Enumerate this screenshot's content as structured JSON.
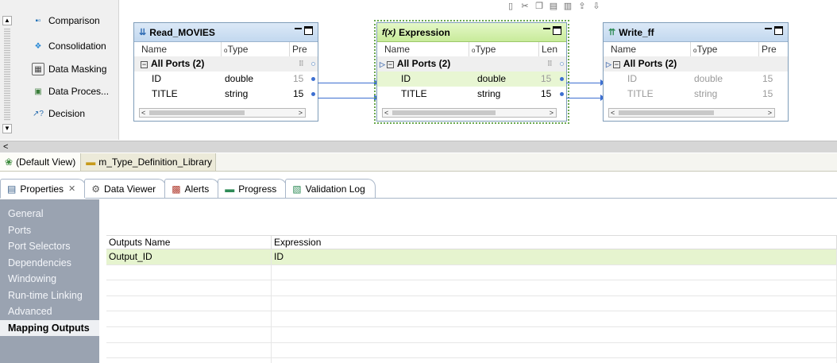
{
  "palette": {
    "items": [
      {
        "label": "Comparison",
        "icon": "comparison-icon"
      },
      {
        "label": "Consolidation",
        "icon": "consolidation-icon"
      },
      {
        "label": "Data Masking",
        "icon": "data-masking-icon"
      },
      {
        "label": "Data Proces...",
        "icon": "data-processor-icon"
      },
      {
        "label": "Decision",
        "icon": "decision-icon"
      }
    ]
  },
  "transformations": {
    "read": {
      "title": "Read_MOVIES",
      "columns": [
        "Name",
        "Type",
        "Pre"
      ],
      "group": "All Ports (2)",
      "ports": [
        {
          "name": "ID",
          "type": "double",
          "precision": "15"
        },
        {
          "name": "TITLE",
          "type": "string",
          "precision": "15"
        }
      ]
    },
    "expression": {
      "title": "Expression",
      "icon_label": "f(x)",
      "columns": [
        "Name",
        "Type",
        "Len"
      ],
      "group": "All Ports (2)",
      "ports": [
        {
          "name": "ID",
          "type": "double",
          "precision": "15"
        },
        {
          "name": "TITLE",
          "type": "string",
          "precision": "15"
        }
      ]
    },
    "write": {
      "title": "Write_ff",
      "columns": [
        "Name",
        "Type",
        "Pre"
      ],
      "group": "All Ports (2)",
      "ports": [
        {
          "name": "ID",
          "type": "double",
          "precision": "15"
        },
        {
          "name": "TITLE",
          "type": "string",
          "precision": "15"
        }
      ]
    }
  },
  "view_tabs": [
    {
      "label": "(Default View)",
      "icon": "view-icon"
    },
    {
      "label": "m_Type_Definition_Library",
      "icon": "folder-icon"
    }
  ],
  "property_tabs": [
    {
      "label": "Properties",
      "icon": "properties-icon",
      "active": true,
      "closable": true
    },
    {
      "label": "Data Viewer",
      "icon": "data-viewer-icon"
    },
    {
      "label": "Alerts",
      "icon": "alerts-icon"
    },
    {
      "label": "Progress",
      "icon": "progress-icon"
    },
    {
      "label": "Validation Log",
      "icon": "validation-log-icon"
    }
  ],
  "left_nav": {
    "items": [
      "General",
      "Ports",
      "Port Selectors",
      "Dependencies",
      "Windowing",
      "Run-time Linking",
      "Advanced",
      "Mapping Outputs"
    ],
    "active": "Mapping Outputs"
  },
  "outputs_grid": {
    "headers": [
      "Outputs Name",
      "Expression"
    ],
    "rows": [
      [
        "Output_ID",
        "ID"
      ]
    ],
    "empty_rows": 7
  },
  "colors": {
    "link": "#3d6fd1",
    "selected_header": "#c8eb9a",
    "nav_bg": "#9aa3b1",
    "selected_row": "#e6f4cf"
  }
}
